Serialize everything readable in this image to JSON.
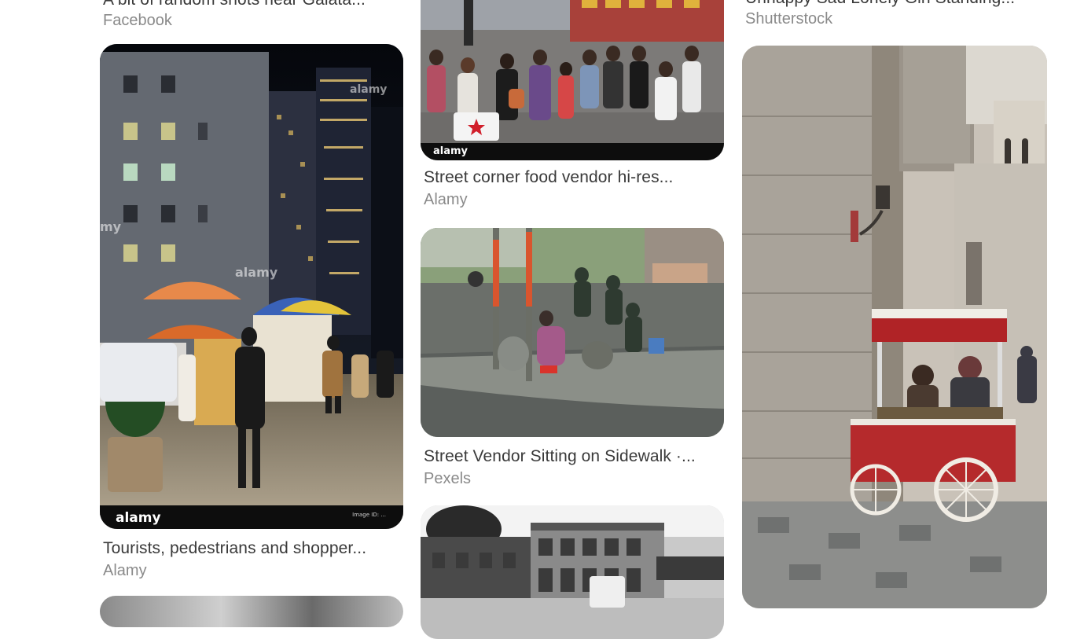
{
  "pins": {
    "col1_top": {
      "title": "A bit of random shots near Galata...",
      "source": "Facebook"
    },
    "col3_top": {
      "title": "Unhappy Sad Lonely Girl Standing...",
      "source": "Shutterstock"
    },
    "pin_nyc": {
      "title": "Tourists, pedestrians and shopper...",
      "source": "Alamy",
      "watermark": "alamy",
      "footer": "alamy",
      "footer_small": "Image ID: ..."
    },
    "pin_food": {
      "title": "Street corner food vendor hi-res...",
      "source": "Alamy",
      "footer": "alamy"
    },
    "pin_sidewalk": {
      "title": "Street Vendor Sitting on Sidewalk ·...",
      "source": "Pexels"
    },
    "pin_chestnut": {
      "title": "",
      "source": ""
    },
    "pin_bw": {
      "title": "",
      "source": ""
    }
  },
  "image_descriptions": {
    "pin_nyc": "night street with skyscrapers and food carts",
    "pin_food": "crowded street market",
    "pin_sidewalk": "vendor sitting on a street corner",
    "pin_chestnut": "red chestnut cart beside stone building",
    "pin_bw": "black and white street with buildings"
  }
}
